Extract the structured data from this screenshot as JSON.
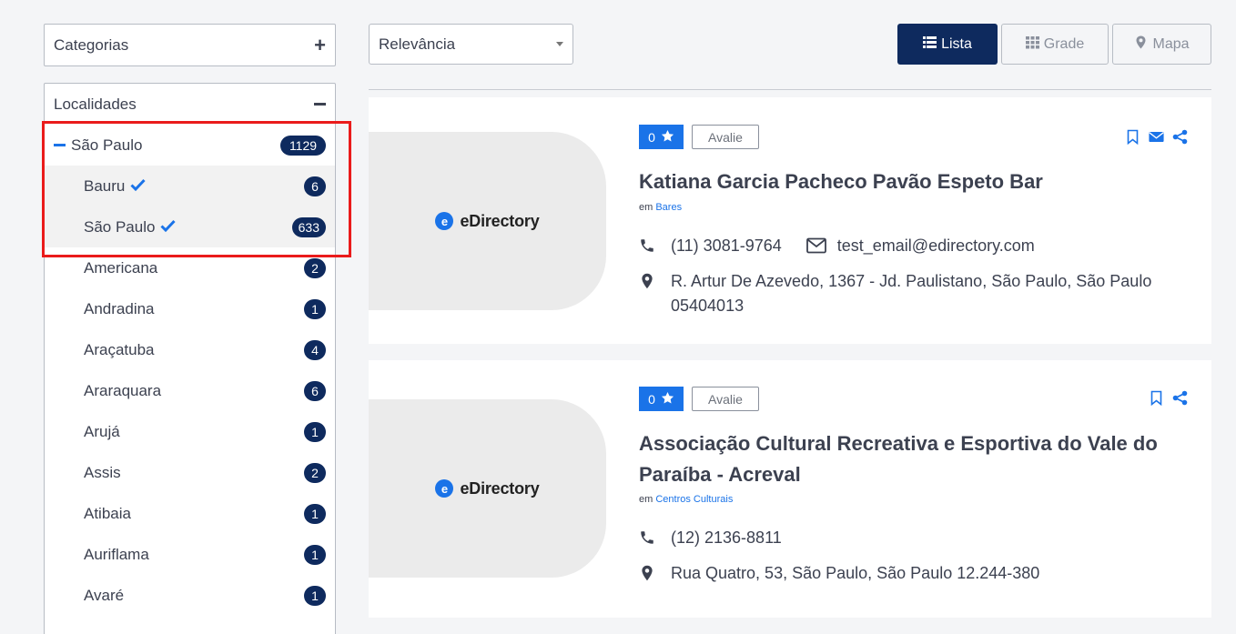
{
  "sidebar": {
    "categories_label": "Categorias",
    "localities_label": "Localidades",
    "parent": {
      "label": "São Paulo",
      "count": "1129"
    },
    "items": [
      {
        "label": "Bauru",
        "count": "6"
      },
      {
        "label": "São Paulo",
        "count": "633"
      },
      {
        "label": "Americana",
        "count": "2"
      },
      {
        "label": "Andradina",
        "count": "1"
      },
      {
        "label": "Araçatuba",
        "count": "4"
      },
      {
        "label": "Araraquara",
        "count": "6"
      },
      {
        "label": "Arujá",
        "count": "1"
      },
      {
        "label": "Assis",
        "count": "2"
      },
      {
        "label": "Atibaia",
        "count": "1"
      },
      {
        "label": "Auriflama",
        "count": "1"
      },
      {
        "label": "Avaré",
        "count": "1"
      }
    ]
  },
  "sort": {
    "value": "Relevância"
  },
  "views": {
    "list": "Lista",
    "grid": "Grade",
    "map": "Mapa"
  },
  "listings": [
    {
      "logo_text": "eDirectory",
      "rating": "0",
      "rate_label": "Avalie",
      "title": "Katiana Garcia Pacheco Pavão Espeto Bar",
      "in_label": "em",
      "category": "Bares",
      "phone": "(11) 3081-9764",
      "email": "test_email@edirectory.com",
      "address": "R. Artur De Azevedo, 1367 - Jd. Paulistano, São Paulo, São Paulo 05404013"
    },
    {
      "logo_text": "eDirectory",
      "rating": "0",
      "rate_label": "Avalie",
      "title": "Associação Cultural Recreativa e Esportiva do Vale do Paraíba - Acreval",
      "in_label": "em",
      "category": "Centros Culturais",
      "phone": "(12) 2136-8811",
      "address": "Rua Quatro, 53, São Paulo, São Paulo 12.244-380"
    }
  ],
  "colors": {
    "accent": "#1a73e8",
    "navy": "#0e2a5e",
    "highlight": "#ea1b1b"
  }
}
